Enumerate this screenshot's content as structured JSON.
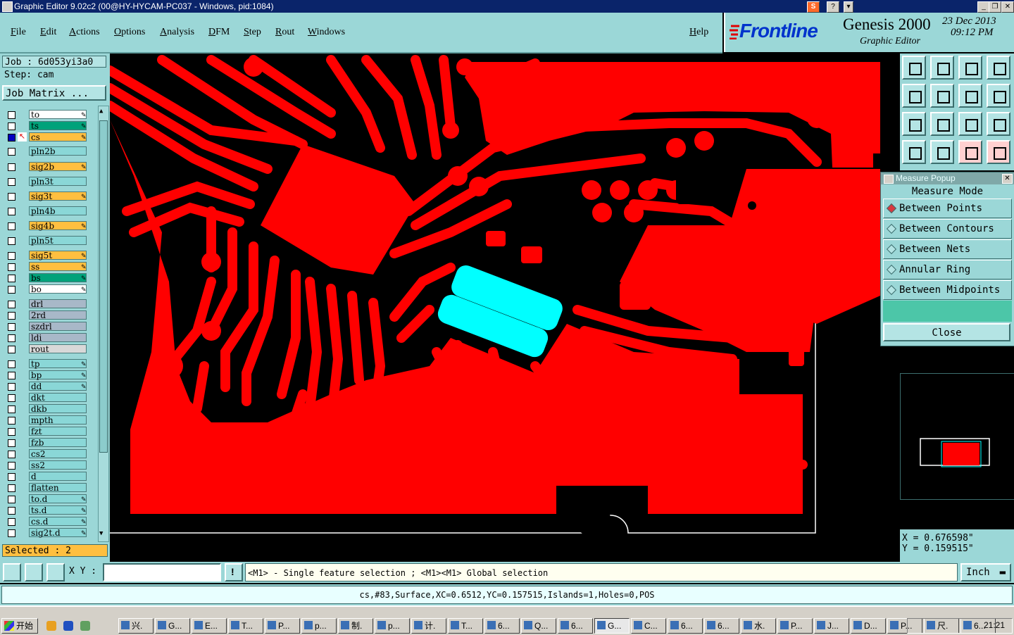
{
  "window": {
    "title": "Graphic Editor 9.02c2 (00@HY-HYCAM-PC037 - Windows, pid:1084)"
  },
  "menu": [
    "File",
    "Edit",
    "Actions",
    "Options",
    "Analysis",
    "DFM",
    "Step",
    "Rout",
    "Windows"
  ],
  "help_label": "Help",
  "brand": {
    "logo": "Frontline",
    "product": "Genesis 2000",
    "subtitle": "Graphic Editor",
    "date": "23 Dec 2013",
    "time": "09:12 PM"
  },
  "job": {
    "job_label": "Job : 6d053yi3a0",
    "step_label": "Step: cam",
    "matrix_button": "Job Matrix ..."
  },
  "layers": [
    {
      "name": "to",
      "color": "#ffffff",
      "editable": true
    },
    {
      "name": "ts",
      "color": "#00a27a",
      "editable": true
    },
    {
      "name": "cs",
      "color": "#ffbf40",
      "editable": true,
      "active": true
    },
    {
      "name": "pln2b",
      "color": "#8ad7d7",
      "editable": false
    },
    {
      "name": "sig2b",
      "color": "#ffbf40",
      "editable": true
    },
    {
      "name": "pln3t",
      "color": "#8ad7d7",
      "editable": false
    },
    {
      "name": "sig3t",
      "color": "#ffbf40",
      "editable": true
    },
    {
      "name": "pln4b",
      "color": "#8ad7d7",
      "editable": false
    },
    {
      "name": "sig4b",
      "color": "#ffbf40",
      "editable": true
    },
    {
      "name": "pln5t",
      "color": "#8ad7d7",
      "editable": false
    },
    {
      "name": "sig5t",
      "color": "#ffbf40",
      "editable": true
    },
    {
      "name": "ss",
      "color": "#ffbf40",
      "editable": true
    },
    {
      "name": "bs",
      "color": "#00a27a",
      "editable": true
    },
    {
      "name": "bo",
      "color": "#ffffff",
      "editable": true
    },
    {
      "name": "drl",
      "color": "#a8b8c8",
      "editable": false
    },
    {
      "name": "2rd",
      "color": "#a8b8c8",
      "editable": false
    },
    {
      "name": "szdrl",
      "color": "#a8b8c8",
      "editable": false
    },
    {
      "name": "ldi",
      "color": "#a8b8c8",
      "editable": false
    },
    {
      "name": "rout",
      "color": "#d8d8d8",
      "editable": false
    },
    {
      "name": "tp",
      "color": "#8ad7d7",
      "editable": true
    },
    {
      "name": "bp",
      "color": "#8ad7d7",
      "editable": true
    },
    {
      "name": "dd",
      "color": "#8ad7d7",
      "editable": true
    },
    {
      "name": "dkt",
      "color": "#8ad7d7",
      "editable": false
    },
    {
      "name": "dkb",
      "color": "#8ad7d7",
      "editable": false
    },
    {
      "name": "mpth",
      "color": "#8ad7d7",
      "editable": false
    },
    {
      "name": "fzt",
      "color": "#8ad7d7",
      "editable": false
    },
    {
      "name": "fzb",
      "color": "#8ad7d7",
      "editable": false
    },
    {
      "name": "cs2",
      "color": "#8ad7d7",
      "editable": false
    },
    {
      "name": "ss2",
      "color": "#8ad7d7",
      "editable": false
    },
    {
      "name": "d",
      "color": "#8ad7d7",
      "editable": false
    },
    {
      "name": "flatten",
      "color": "#8ad7d7",
      "editable": false
    },
    {
      "name": "to.d",
      "color": "#8ad7d7",
      "editable": true
    },
    {
      "name": "ts.d",
      "color": "#8ad7d7",
      "editable": true
    },
    {
      "name": "cs.d",
      "color": "#8ad7d7",
      "editable": true
    },
    {
      "name": "sig2t.d",
      "color": "#8ad7d7",
      "editable": true
    }
  ],
  "selected_label": "Selected : 2",
  "measure_popup": {
    "title": "Measure Popup",
    "mode_label": "Measure Mode",
    "modes": [
      "Between Points",
      "Between Contours",
      "Between Nets",
      "Annular Ring",
      "Between Midpoints"
    ],
    "selected_mode": "Between Points",
    "close_label": "Close"
  },
  "coords": {
    "x": "X = 0.676598\"",
    "y": "Y = 0.159515\""
  },
  "xy_label": "X Y :",
  "xy_input": "",
  "hint": "<M1> - Single feature selection ; <M1><M1> Global selection",
  "units": "Inch",
  "status": "cs,#83,Surface,XC=0.6512,YC=0.157515,Islands=1,Holes=0,POS",
  "taskbar": {
    "start": "开始",
    "tasks": [
      "兴.",
      "G...",
      "E...",
      "T...",
      "P...",
      "p...",
      "制.",
      "p...",
      "计.",
      "T...",
      "6...",
      "Q...",
      "6...",
      "G...",
      "C...",
      "6...",
      "6...",
      "水.",
      "P...",
      "J...",
      "D...",
      "P...",
      "尺.",
      "6..."
    ],
    "clock": "21:21"
  },
  "colors": {
    "copper": "#ff0000",
    "selected": "#00ffff",
    "panel": "#9bd7d7"
  }
}
